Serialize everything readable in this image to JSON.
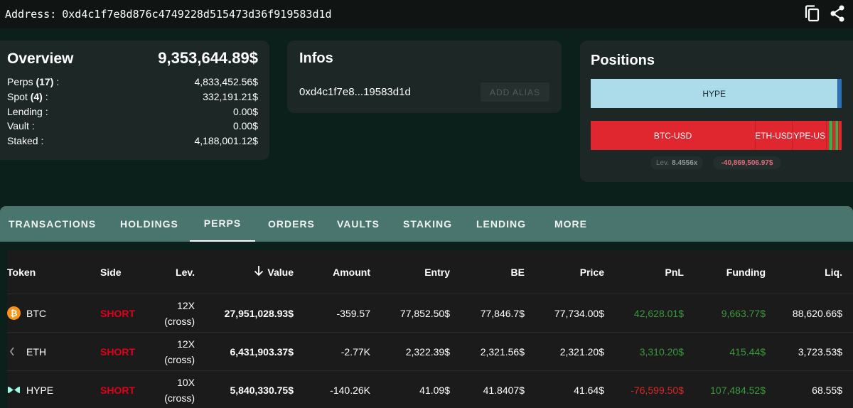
{
  "address": {
    "label": "Address:",
    "value": "0xd4c1f7e8d876c4749228d515473d36f919583d1d"
  },
  "overview": {
    "title": "Overview",
    "total": "9,353,644.89$",
    "rows": [
      {
        "label": "Perps",
        "count": "(17)",
        "suffix": " :",
        "value": "4,833,452.56$"
      },
      {
        "label": "Spot",
        "count": "(4)",
        "suffix": " :",
        "value": "332,191.21$"
      },
      {
        "label": "Lending :",
        "count": "",
        "suffix": "",
        "value": "0.00$"
      },
      {
        "label": "Vault :",
        "count": "",
        "suffix": "",
        "value": "0.00$"
      },
      {
        "label": "Staked :",
        "count": "",
        "suffix": "",
        "value": "4,188,001.12$"
      }
    ]
  },
  "infos": {
    "title": "Infos",
    "short_address": "0xd4c1f7e8...19583d1d",
    "alias_button": "ADD ALIAS"
  },
  "positions": {
    "title": "Positions",
    "spot_segments": [
      {
        "label": "HYPE",
        "share": 0.984,
        "color": "#acdbe9"
      },
      {
        "label": "",
        "share": 0.016,
        "color": "#2f6fb3"
      }
    ],
    "perp_segments": [
      {
        "label": "BTC-USD",
        "share": 0.655,
        "color": "#e0262e"
      },
      {
        "label": "ETH-USD",
        "share": 0.148,
        "color": "#e0262e"
      },
      {
        "label": "HYPE-USD",
        "share": 0.135,
        "color": "#e0262e"
      },
      {
        "label": "",
        "share": 0.012,
        "color": "#e0262e"
      },
      {
        "label": "",
        "share": 0.014,
        "color": "#3fae4a"
      },
      {
        "label": "",
        "share": 0.01,
        "color": "#e0262e"
      },
      {
        "label": "",
        "share": 0.012,
        "color": "#3fae4a"
      },
      {
        "label": "",
        "share": 0.014,
        "color": "#e0262e"
      }
    ],
    "lev_label": "Lev.",
    "lev_value": "8.4556x",
    "pnl": "-40,869,506.97$"
  },
  "tabs": [
    {
      "label": "TRANSACTIONS"
    },
    {
      "label": "HOLDINGS"
    },
    {
      "label": "PERPS",
      "active": true
    },
    {
      "label": "ORDERS"
    },
    {
      "label": "VAULTS"
    },
    {
      "label": "STAKING"
    },
    {
      "label": "LENDING"
    },
    {
      "label": "MORE"
    }
  ],
  "table": {
    "headers": {
      "token": "Token",
      "side": "Side",
      "lev": "Lev.",
      "value": "Value",
      "amount": "Amount",
      "entry": "Entry",
      "be": "BE",
      "price": "Price",
      "pnl": "PnL",
      "funding": "Funding",
      "liq": "Liq."
    },
    "sort_icon": "arrow-down-icon",
    "rows": [
      {
        "token": "BTC",
        "icon": "bitcoin-icon",
        "side": "SHORT",
        "lev": "12X",
        "lev_mode": "(cross)",
        "value": "27,951,028.93$",
        "amount": "-359.57",
        "entry": "77,852.50$",
        "be": "77,846.7$",
        "price": "77,734.00$",
        "pnl": "42,628.01$",
        "pnl_sign": "pos",
        "funding": "9,663.77$",
        "funding_sign": "pos",
        "liq": "88,620.66$"
      },
      {
        "token": "ETH",
        "icon": "ethereum-icon",
        "side": "SHORT",
        "lev": "12X",
        "lev_mode": "(cross)",
        "value": "6,431,903.37$",
        "amount": "-2.77K",
        "entry": "2,322.39$",
        "be": "2,321.56$",
        "price": "2,321.20$",
        "pnl": "3,310.20$",
        "pnl_sign": "pos",
        "funding": "415.44$",
        "funding_sign": "pos",
        "liq": "3,723.53$"
      },
      {
        "token": "HYPE",
        "icon": "hyperliquid-icon",
        "side": "SHORT",
        "lev": "10X",
        "lev_mode": "(cross)",
        "value": "5,840,330.75$",
        "amount": "-140.26K",
        "entry": "41.09$",
        "be": "41.8407$",
        "price": "41.64$",
        "pnl": "-76,599.50$",
        "pnl_sign": "neg",
        "funding": "107,484.52$",
        "funding_sign": "pos",
        "liq": "68.55$"
      }
    ]
  }
}
